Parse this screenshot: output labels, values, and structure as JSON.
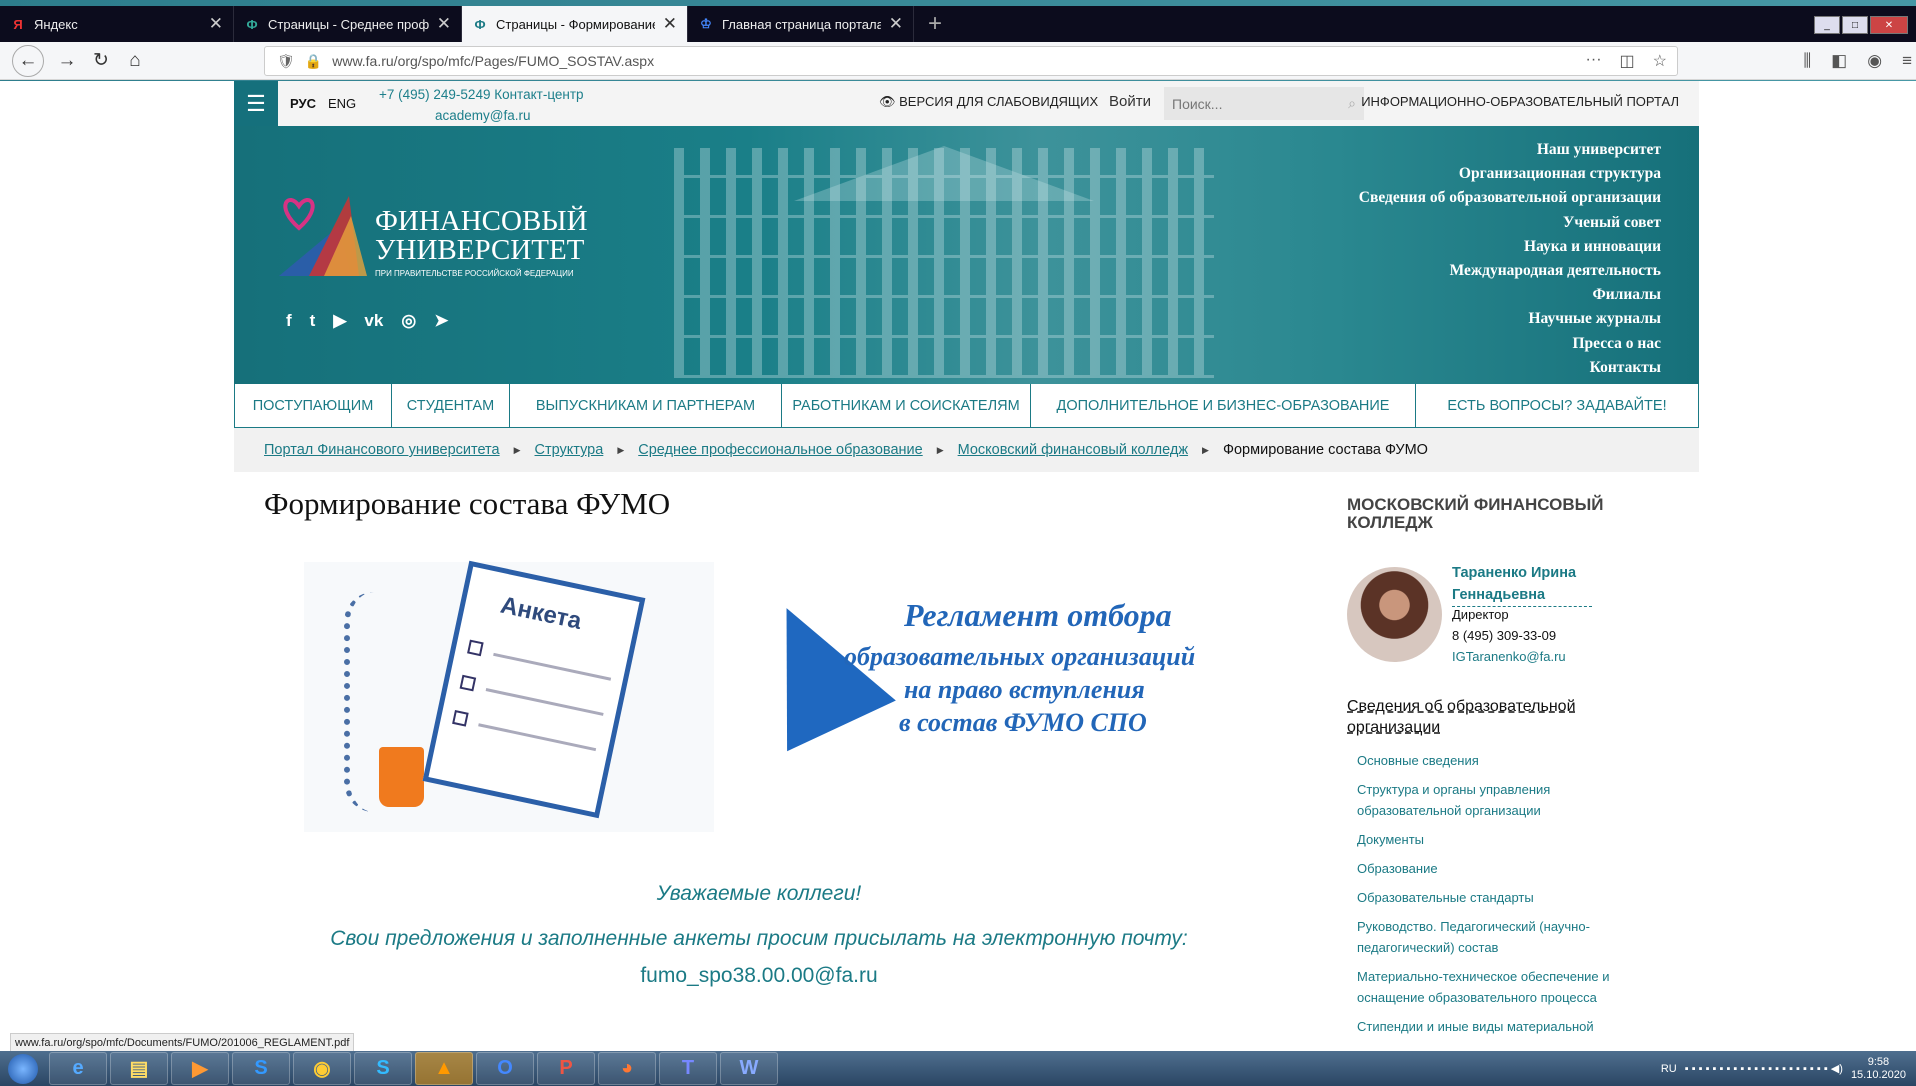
{
  "browser": {
    "tabs": [
      {
        "icon": "Я",
        "title": "Яндекс",
        "active": false
      },
      {
        "icon": "Ф",
        "title": "Страницы - Среднее професс",
        "active": false
      },
      {
        "icon": "Ф",
        "title": "Страницы - Формирование с",
        "active": true
      },
      {
        "icon": "♔",
        "title": "Главная страница портала Ф",
        "active": false
      }
    ],
    "close": "✕",
    "new_tab": "+",
    "url_domain": "www.fa.ru/org/spo/mfc/Pages/FUMO_SOSTAV.aspx",
    "status_url": "www.fa.ru/org/spo/mfc/Documents/FUMO/201006_REGLAMENT.pdf"
  },
  "site": {
    "lang_ru": "РУС",
    "lang_en": "ENG",
    "phone": "+7 (495) 249-5249 Контакт-центр",
    "email": "academy@fa.ru",
    "vision": "👁 ВЕРСИЯ ДЛЯ СЛАБОВИДЯЩИХ",
    "login": "Войти",
    "search_placeholder": "Поиск...",
    "portal": "ИНФОРМАЦИОННО-ОБРАЗОВАТЕЛЬНЫЙ ПОРТАЛ",
    "logo_line1": "ФИНАНСОВЫЙ",
    "logo_line2": "УНИВЕРСИТЕТ",
    "logo_line3": "ПРИ ПРАВИТЕЛЬСТВЕ РОССИЙСКОЙ ФЕДЕРАЦИИ",
    "social": [
      "f",
      "t",
      "▶",
      "vk",
      "◎",
      "➤"
    ],
    "right_menu": [
      "Наш университет",
      "Организационная структура",
      "Сведения об образовательной организации",
      "Ученый совет",
      "Наука и инновации",
      "Международная деятельность",
      "Филиалы",
      "Научные журналы",
      "Пресса о нас",
      "Контакты"
    ],
    "main_nav": [
      "ПОСТУПАЮЩИМ",
      "СТУДЕНТАМ",
      "ВЫПУСКНИКАМ И ПАРТНЕРАМ",
      "РАБОТНИКАМ И СОИСКАТЕЛЯМ",
      "ДОПОЛНИТЕЛЬНОЕ И БИЗНЕС-ОБРАЗОВАНИЕ",
      "ЕСТЬ ВОПРОСЫ? ЗАДАВАЙТЕ!"
    ],
    "breadcrumbs": [
      "Портал Финансового университета",
      "Структура",
      "Среднее профессиональное образование",
      "Московский финансовый колледж"
    ],
    "breadcrumb_current": "Формирование состава ФУМО"
  },
  "main": {
    "title": "Формирование состава ФУМО",
    "anketa_title": "Анкета",
    "reg_line1": "Регламент отбора",
    "reg_line2": "образовательных организаций",
    "reg_line3": "на право вступления",
    "reg_line4": "в состав ФУМО СПО",
    "greeting": "Уважаемые коллеги!",
    "request": "Свои предложения и заполненные анкеты просим присылать на электронную почту:",
    "mail": "fumo_spo38.00.00@fa.ru"
  },
  "aside": {
    "heading": "МОСКОВСКИЙ ФИНАНСОВЫЙ КОЛЛЕДЖ",
    "director_name": "Тараненко Ирина Геннадьевна",
    "director_position": "Директор",
    "director_phone": "8 (495) 309-33-09",
    "director_email": "IGTaranenko@fa.ru",
    "info_heading": "Сведения об образовательной организации",
    "links": [
      "Основные сведения",
      "Структура и органы управления образовательной организации",
      "Документы",
      "Образование",
      "Образовательные стандарты",
      "Руководство. Педагогический (научно-педагогический) состав",
      "Материально-техническое обеспечение и оснащение образовательного процесса",
      "Стипендии и иные виды материальной"
    ]
  },
  "taskbar": {
    "apps": [
      "e",
      "▤",
      "▶",
      "S",
      "◉",
      "S",
      "▲",
      "O",
      "P",
      "◕",
      "T",
      "W"
    ],
    "lang": "RU",
    "time": "9:58",
    "date": "15.10.2020"
  }
}
